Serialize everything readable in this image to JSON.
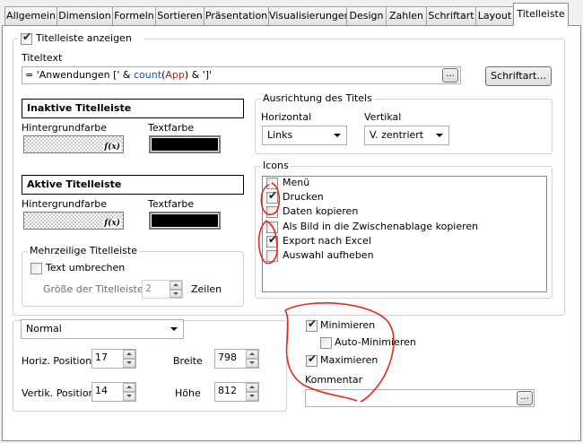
{
  "tabs": [
    {
      "label": "Allgemein"
    },
    {
      "label": "Dimension"
    },
    {
      "label": "Formeln"
    },
    {
      "label": "Sortieren"
    },
    {
      "label": "Präsentation"
    },
    {
      "label": "Visualisierungen"
    },
    {
      "label": "Design"
    },
    {
      "label": "Zahlen"
    },
    {
      "label": "Schriftart"
    },
    {
      "label": "Layout"
    },
    {
      "label": "Titelleiste"
    }
  ],
  "active_tab": "Titelleiste",
  "show_title": {
    "label": "Titelleiste anzeigen",
    "checked": true
  },
  "title_text": {
    "label": "Titeltext",
    "prefix": "= 'Anwendungen [' & ",
    "func": "count",
    "paren_open": "(",
    "field": "App",
    "suffix": ") & ']'",
    "browse": "...",
    "font_button": "Schriftart..."
  },
  "inactive": {
    "heading": "Inaktive Titelleiste",
    "bg_label": "Hintergrundfarbe",
    "text_label": "Textfarbe",
    "fx": "f(x)"
  },
  "active": {
    "heading": "Aktive Titelleiste",
    "bg_label": "Hintergrundfarbe",
    "text_label": "Textfarbe",
    "fx": "f(x)"
  },
  "multiline": {
    "legend": "Mehrzeilige Titelleiste",
    "wrap_label": "Text umbrechen",
    "size_label": "Größe der Titelleiste",
    "size_value": "2",
    "lines_label": "Zeilen"
  },
  "alignment": {
    "legend": "Ausrichtung des Titels",
    "horizontal_label": "Horizontal",
    "horizontal_value": "Links",
    "vertical_label": "Vertikal",
    "vertical_value": "V. zentriert"
  },
  "icons": {
    "legend": "Icons",
    "items": [
      {
        "label": "Menü",
        "checked": false
      },
      {
        "label": "Drucken",
        "checked": true
      },
      {
        "label": "Daten kopieren",
        "checked": false
      },
      {
        "label": "Als Bild in die Zwischenablage kopieren",
        "checked": false
      },
      {
        "label": "Export nach Excel",
        "checked": true
      },
      {
        "label": "Auswahl aufheben",
        "checked": false
      }
    ]
  },
  "position": {
    "mode": "Normal",
    "horiz_label": "Horiz. Position",
    "horiz_value": "17",
    "vert_label": "Vertik. Position",
    "vert_value": "14",
    "width_label": "Breite",
    "width_value": "798",
    "height_label": "Höhe",
    "height_value": "812"
  },
  "window": {
    "minimize_label": "Minimieren",
    "minimize_checked": true,
    "auto_minimize_label": "Auto-Minimieren",
    "auto_minimize_checked": false,
    "maximize_label": "Maximieren",
    "maximize_checked": true,
    "comment_label": "Kommentar",
    "comment_browse": "..."
  },
  "check_glyph": "✔",
  "colors": {
    "annotation": "#e8281e",
    "func_blue": "#1f47c8",
    "field_red": "#a0281e"
  }
}
